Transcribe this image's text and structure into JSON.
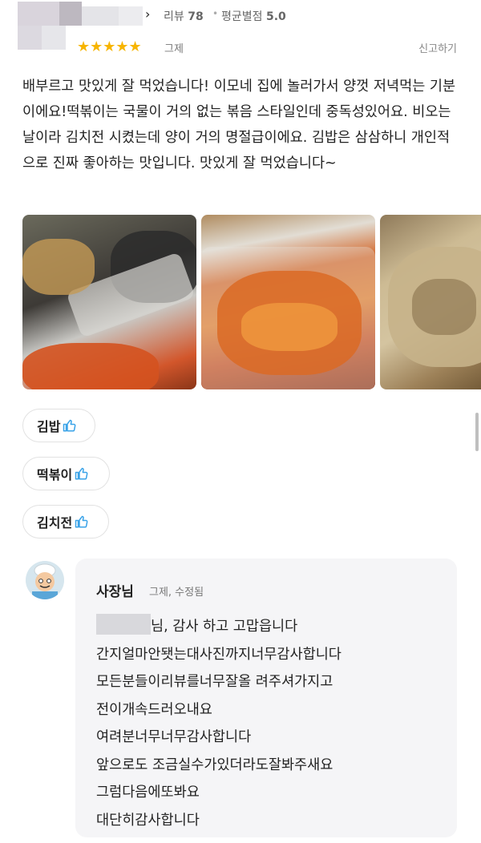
{
  "header": {
    "chevron": "›",
    "review_label": "리뷰",
    "review_count": "78",
    "separator": "•",
    "avg_label": "평균별점",
    "avg_rating": "5.0",
    "stars": "★★★★★",
    "rating": 5,
    "date": "그제",
    "report": "신고하기"
  },
  "review": {
    "text": "배부르고 맛있게 잘 먹었습니다! 이모네 집에 놀러가서 양껏 저녁먹는 기분이에요!떡볶이는 국물이 거의 없는 볶음 스타일인데 중독성있어요. 비오는 날이라 김치전 시켰는데 양이 거의 명절급이에요. 김밥은 삼삼하니 개인적으로 진짜 좋아하는 맛입니다. 맛있게 잘 먹었습니다~"
  },
  "menu_tags": [
    {
      "label": "김밥"
    },
    {
      "label": "떡볶이"
    },
    {
      "label": "김치전"
    }
  ],
  "reply": {
    "owner": "사장님",
    "meta": "그제, 수정됨",
    "lines": [
      "님, 감사 하고 고맙읍니다",
      "간지얼마안됏는대사진까지너무감사합니다",
      "모든분들이리뷰를너무잘올 려주셔가지고",
      "전이개속드러오내요",
      "여려분너무너무감사합니다",
      "앞으로도 조금실수가있더라도잘봐주새요",
      "그럼다음에또봐요",
      "대단히감사합니다"
    ]
  },
  "colors": {
    "star": "#f7b500",
    "thumb": "#3aa3e8",
    "reply_bg": "#f5f5f7"
  }
}
